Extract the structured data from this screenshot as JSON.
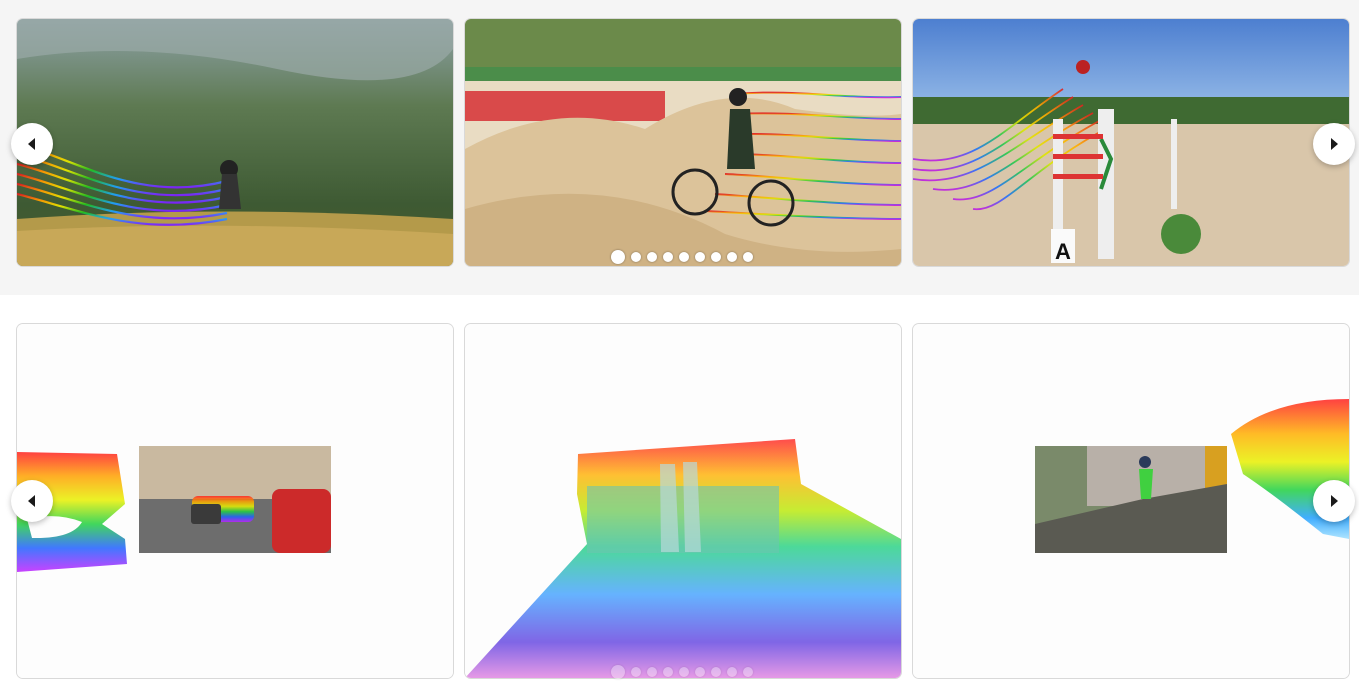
{
  "colors": {
    "top_band_background": "#f5f5f5",
    "page_background": "#ffffff",
    "nav_button": "#ffffff",
    "nav_arrow": "#1a1a1a",
    "dot": "#ffffff"
  },
  "top_carousel": {
    "slides": [
      {
        "subject": "paraglider-tracks",
        "sign_text": ""
      },
      {
        "subject": "bmx-rider-tracks",
        "sign_text": ""
      },
      {
        "subject": "show-jumping-horse-tracks",
        "sign_text": "A"
      }
    ],
    "pagination": {
      "count": 9,
      "active_index": 0
    },
    "icons": {
      "prev": "chevron-left-icon",
      "next": "chevron-right-icon"
    }
  },
  "bottom_carousel": {
    "slides": [
      {
        "subject": "car-point-cloud"
      },
      {
        "subject": "people-point-cloud"
      },
      {
        "subject": "skater-point-cloud"
      }
    ],
    "pagination": {
      "count": 9,
      "active_index": 0
    },
    "icons": {
      "prev": "chevron-left-icon",
      "next": "chevron-right-icon"
    }
  }
}
